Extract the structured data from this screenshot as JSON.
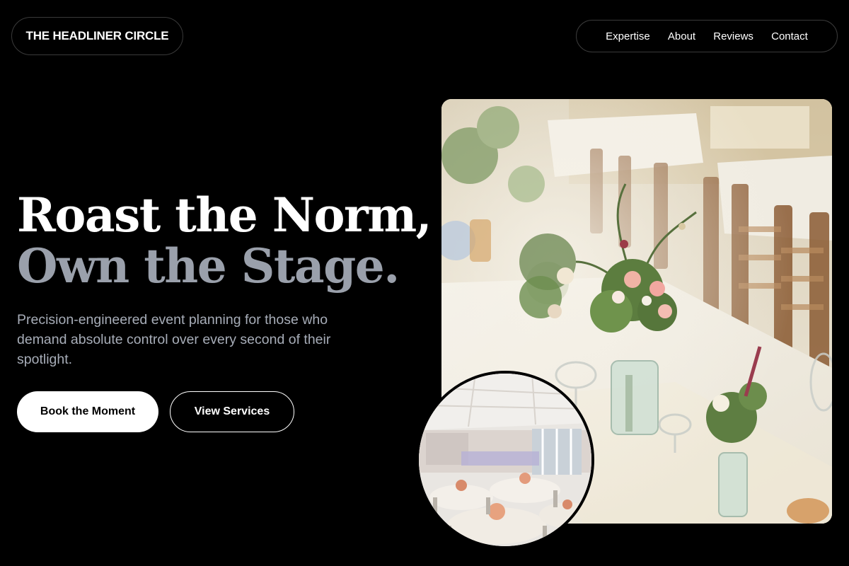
{
  "header": {
    "brand": "THE HEADLINER CIRCLE",
    "nav": [
      {
        "label": "Expertise"
      },
      {
        "label": "About"
      },
      {
        "label": "Reviews"
      },
      {
        "label": "Contact"
      }
    ]
  },
  "hero": {
    "headline_line1": "Roast the Norm,",
    "headline_line2": "Own the Stage.",
    "subtext": "Precision-engineered event planning for those who demand absolute control over every second of their spotlight.",
    "primary_button": "Book the Moment",
    "secondary_button": "View Services"
  },
  "images": {
    "main": "table-flowers-photo",
    "inset": "banquet-hall-photo"
  },
  "colors": {
    "background": "#000000",
    "headline_primary": "#ffffff",
    "headline_secondary": "#9aa0ab",
    "subtext": "#a7adb8"
  }
}
